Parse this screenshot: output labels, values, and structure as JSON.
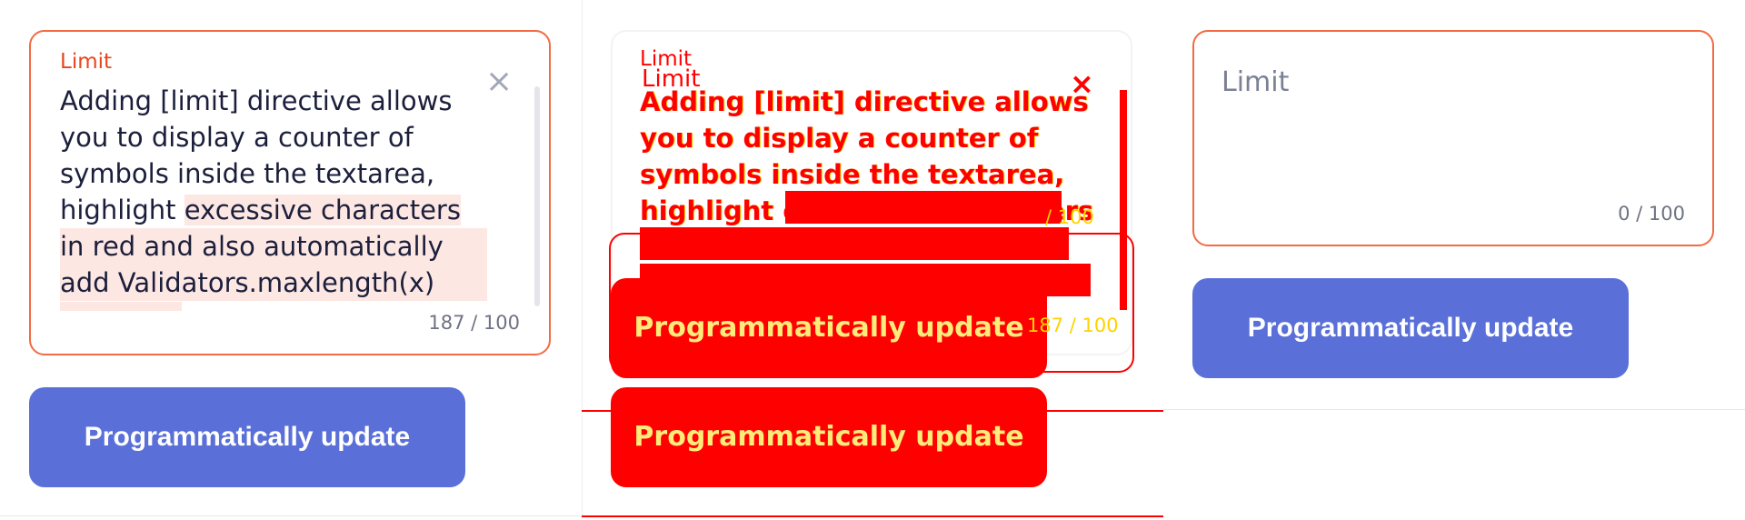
{
  "cards": {
    "card1": {
      "label": "Limit",
      "lines": [
        "Adding [limit] directive allows",
        "you to display a counter of",
        "symbols inside the textarea,",
        "highlight ",
        "excessive characters",
        "in red and also automatically",
        "add Validators.maxlength(x)"
      ],
      "counter": "187 / 100",
      "button": "Programmatically update"
    },
    "card2": {
      "label": "Limit",
      "lines": [
        "Adding [limit] directive allows",
        "you to display a counter of",
        "symbols inside the textarea,",
        "highlight excessive characters"
      ],
      "counter_a": "/ 100",
      "counter_b": "187 / 100",
      "button": "Programmatically update"
    },
    "card3": {
      "placeholder": "Limit",
      "counter": "0 / 100",
      "button": "Programmatically update"
    }
  },
  "colors": {
    "accent_border": "#f26b42",
    "button_bg": "#5a70d8",
    "highlight_bg": "#fde7e3",
    "glitch_red": "#ff0000"
  },
  "icons": {
    "close": "close-icon"
  }
}
